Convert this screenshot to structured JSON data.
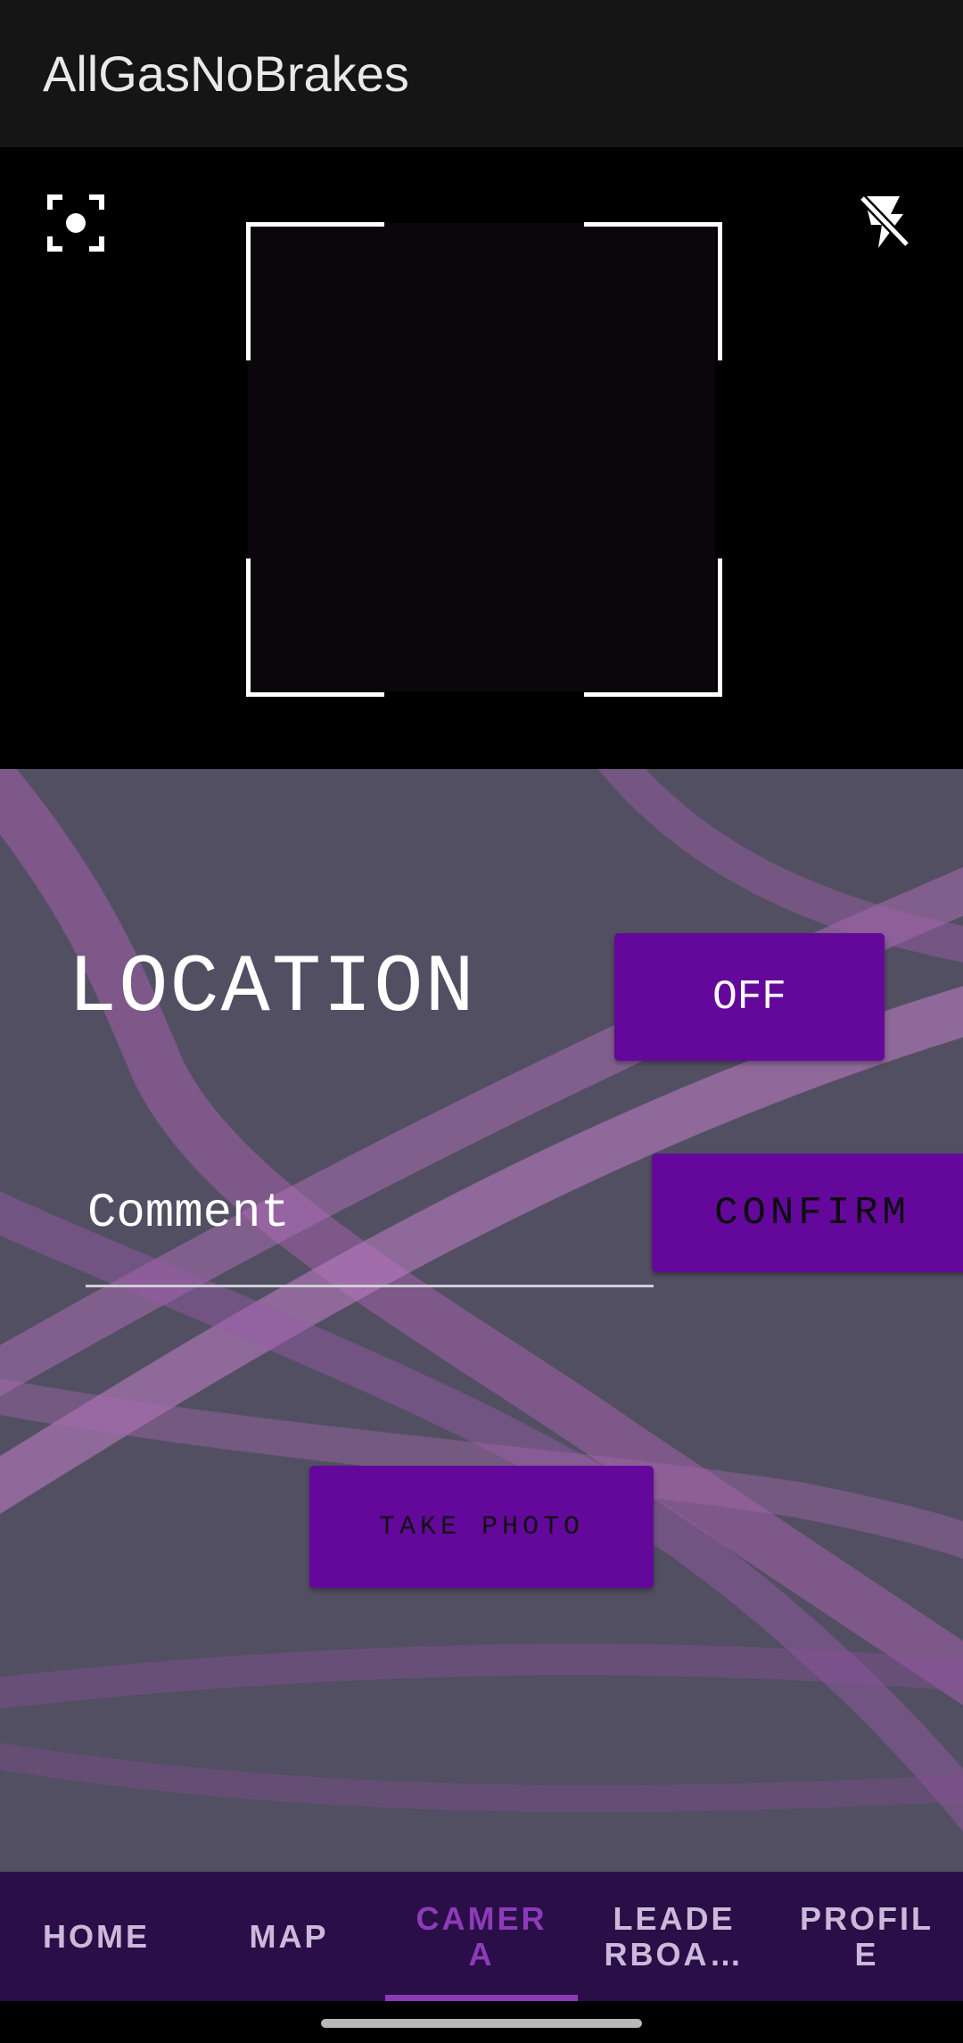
{
  "app_bar": {
    "title": "AllGasNoBrakes"
  },
  "camera": {
    "focus_icon": "focus-mode-icon",
    "flash_icon": "flash-off-icon"
  },
  "location": {
    "label": "LOCATION",
    "toggle_label": "OFF"
  },
  "comment": {
    "placeholder": "Comment",
    "value": "",
    "confirm_label": "CONFIRM"
  },
  "photo": {
    "button_label": "TAKE PHOTO"
  },
  "bottom_nav": {
    "tabs": [
      {
        "label": "HOME"
      },
      {
        "label": "MAP"
      },
      {
        "label": "CAMER\nA"
      },
      {
        "label": "LEADE\nRBOA…"
      },
      {
        "label": "PROFIL\nE"
      }
    ],
    "active_tab": "CAMERA"
  },
  "colors": {
    "accent": "#63089a",
    "panel_bg": "#534f63",
    "nav_bg": "#2a0e47",
    "active_tab": "#8d3bb8"
  }
}
